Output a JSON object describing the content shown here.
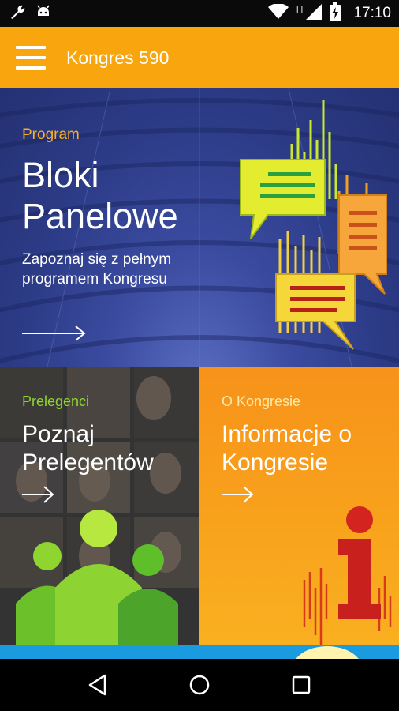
{
  "status_bar": {
    "time": "17:10",
    "network_letter": "H"
  },
  "app_bar": {
    "title": "Kongres 590"
  },
  "tiles": {
    "program": {
      "kicker": "Program",
      "headline_line1": "Bloki",
      "headline_line2": "Panelowe",
      "desc_line1": "Zapoznaj się z pełnym",
      "desc_line2": "programem Kongresu"
    },
    "speakers": {
      "kicker": "Prelegenci",
      "headline_line1": "Poznaj",
      "headline_line2": "Prelegentów"
    },
    "about": {
      "kicker": "O Kongresie",
      "headline_line1": "Informacje o",
      "headline_line2": "Kongresie"
    }
  },
  "colors": {
    "accent_orange": "#f8a50e",
    "hero_blue": "#2c3b86",
    "kicker_green": "#8fd530",
    "kicker_orange": "#f5b026"
  }
}
